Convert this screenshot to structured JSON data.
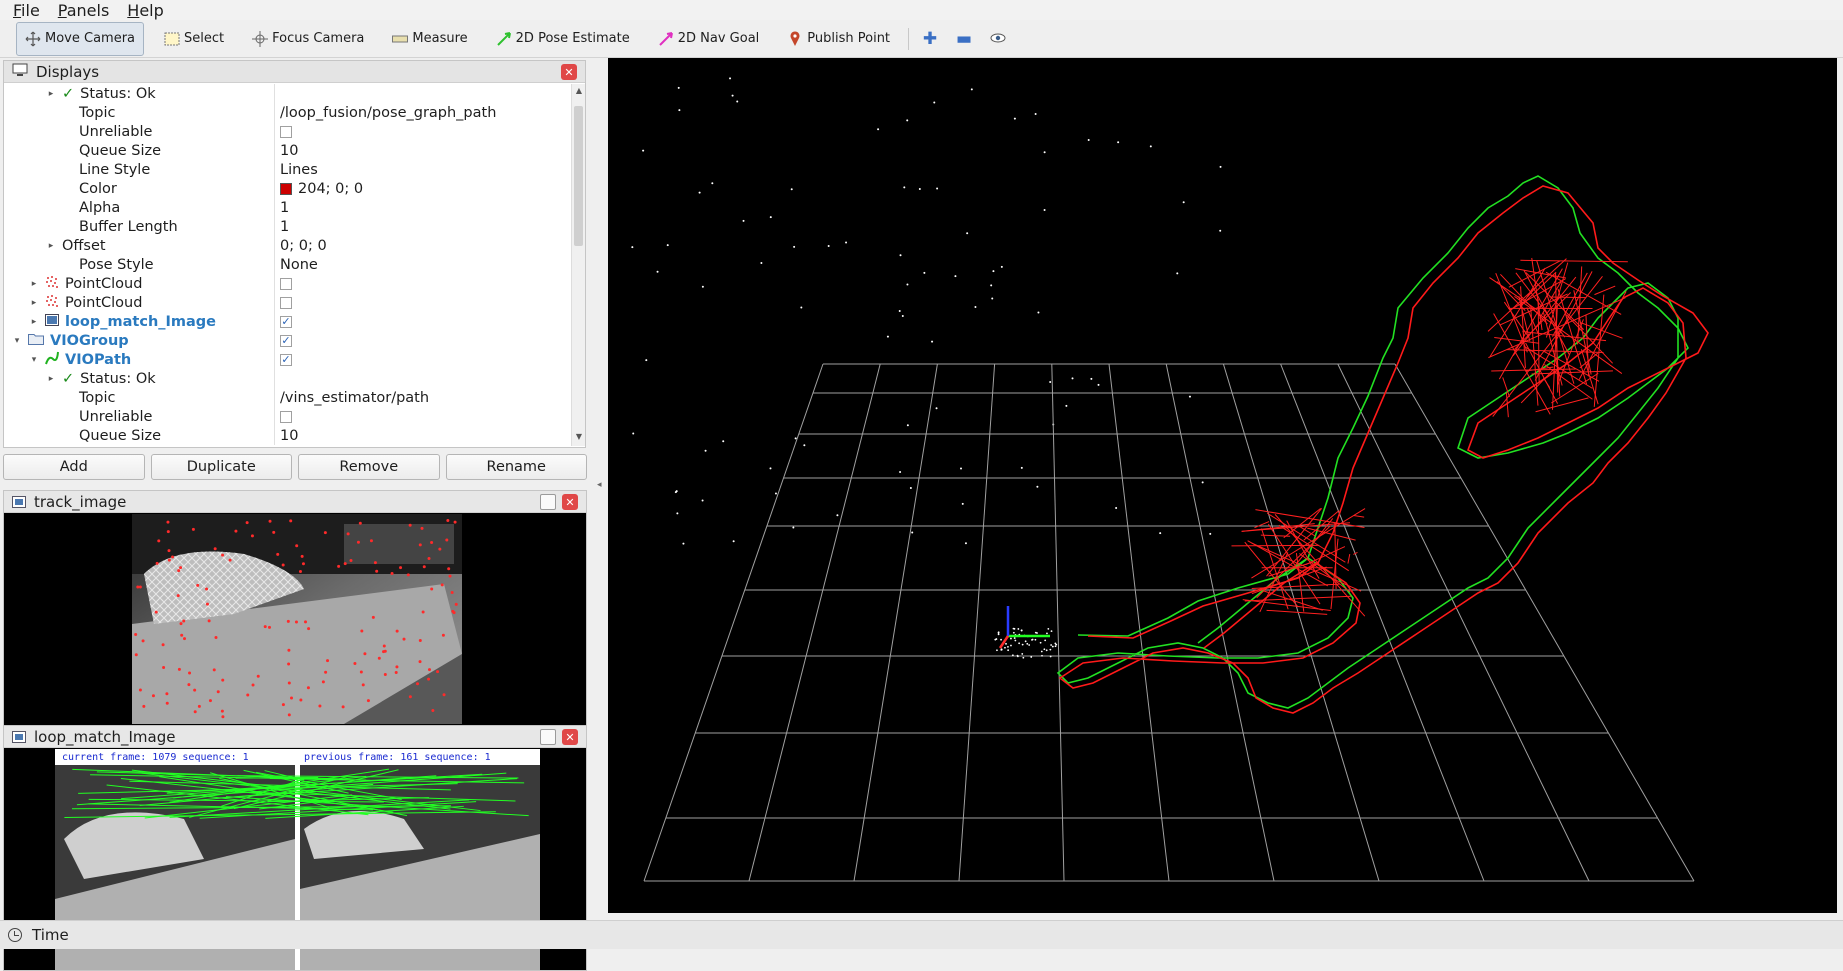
{
  "menu": [
    {
      "label": "File",
      "hot": "F",
      "rest": "ile"
    },
    {
      "label": "Panels",
      "hot": "P",
      "rest": "anels"
    },
    {
      "label": "Help",
      "hot": "H",
      "rest": "elp"
    }
  ],
  "toolbar": {
    "move_camera": "Move Camera",
    "select": "Select",
    "focus_camera": "Focus Camera",
    "measure": "Measure",
    "pose_estimate": "2D Pose Estimate",
    "nav_goal": "2D Nav Goal",
    "publish_point": "Publish Point"
  },
  "displays": {
    "title": "Displays",
    "rows": [
      {
        "indent": 2,
        "arrow": "▸",
        "icon": "check",
        "name": "Status: Ok",
        "value": ""
      },
      {
        "indent": 3,
        "name": "Topic",
        "value": "/loop_fusion/pose_graph_path"
      },
      {
        "indent": 3,
        "name": "Unreliable",
        "value_check": false
      },
      {
        "indent": 3,
        "name": "Queue Size",
        "value": "10"
      },
      {
        "indent": 3,
        "name": "Line Style",
        "value": "Lines"
      },
      {
        "indent": 3,
        "name": "Color",
        "value": "204; 0; 0",
        "swatch": "#cc0000"
      },
      {
        "indent": 3,
        "name": "Alpha",
        "value": "1"
      },
      {
        "indent": 3,
        "name": "Buffer Length",
        "value": "1"
      },
      {
        "indent": 2,
        "arrow": "▸",
        "name": "Offset",
        "value": "0; 0; 0"
      },
      {
        "indent": 3,
        "name": "Pose Style",
        "value": "None"
      },
      {
        "indent": 1,
        "arrow": "▸",
        "icon": "cloud",
        "name": "PointCloud",
        "value_check": false
      },
      {
        "indent": 1,
        "arrow": "▸",
        "icon": "cloud",
        "name": "PointCloud",
        "value_check": false
      },
      {
        "indent": 1,
        "arrow": "▸",
        "icon": "image",
        "name": "loop_match_Image",
        "blue": true,
        "value_check": true
      },
      {
        "indent": 0,
        "arrow": "▾",
        "icon": "folder",
        "name": "VIOGroup",
        "blue": true,
        "value_check": true
      },
      {
        "indent": 1,
        "arrow": "▾",
        "icon": "path",
        "name": "VIOPath",
        "blue": true,
        "value_check": true
      },
      {
        "indent": 2,
        "arrow": "▸",
        "icon": "check",
        "name": "Status: Ok",
        "value": ""
      },
      {
        "indent": 3,
        "name": "Topic",
        "value": "/vins_estimator/path"
      },
      {
        "indent": 3,
        "name": "Unreliable",
        "value_check": false
      },
      {
        "indent": 3,
        "name": "Queue Size",
        "value": "10"
      }
    ]
  },
  "buttons": {
    "add": "Add",
    "duplicate": "Duplicate",
    "remove": "Remove",
    "rename": "Rename"
  },
  "track_panel": {
    "title": "track_image"
  },
  "loop_panel": {
    "title": "loop_match_Image",
    "current_caption": "current frame: 1079   sequence: 1",
    "previous_caption": "previous frame: 161   sequence: 1"
  },
  "time": {
    "title": "Time"
  },
  "colors": {
    "optimized_path": "#ff1a1a",
    "vio_path": "#22e022",
    "grid": "#a0a0a0"
  }
}
